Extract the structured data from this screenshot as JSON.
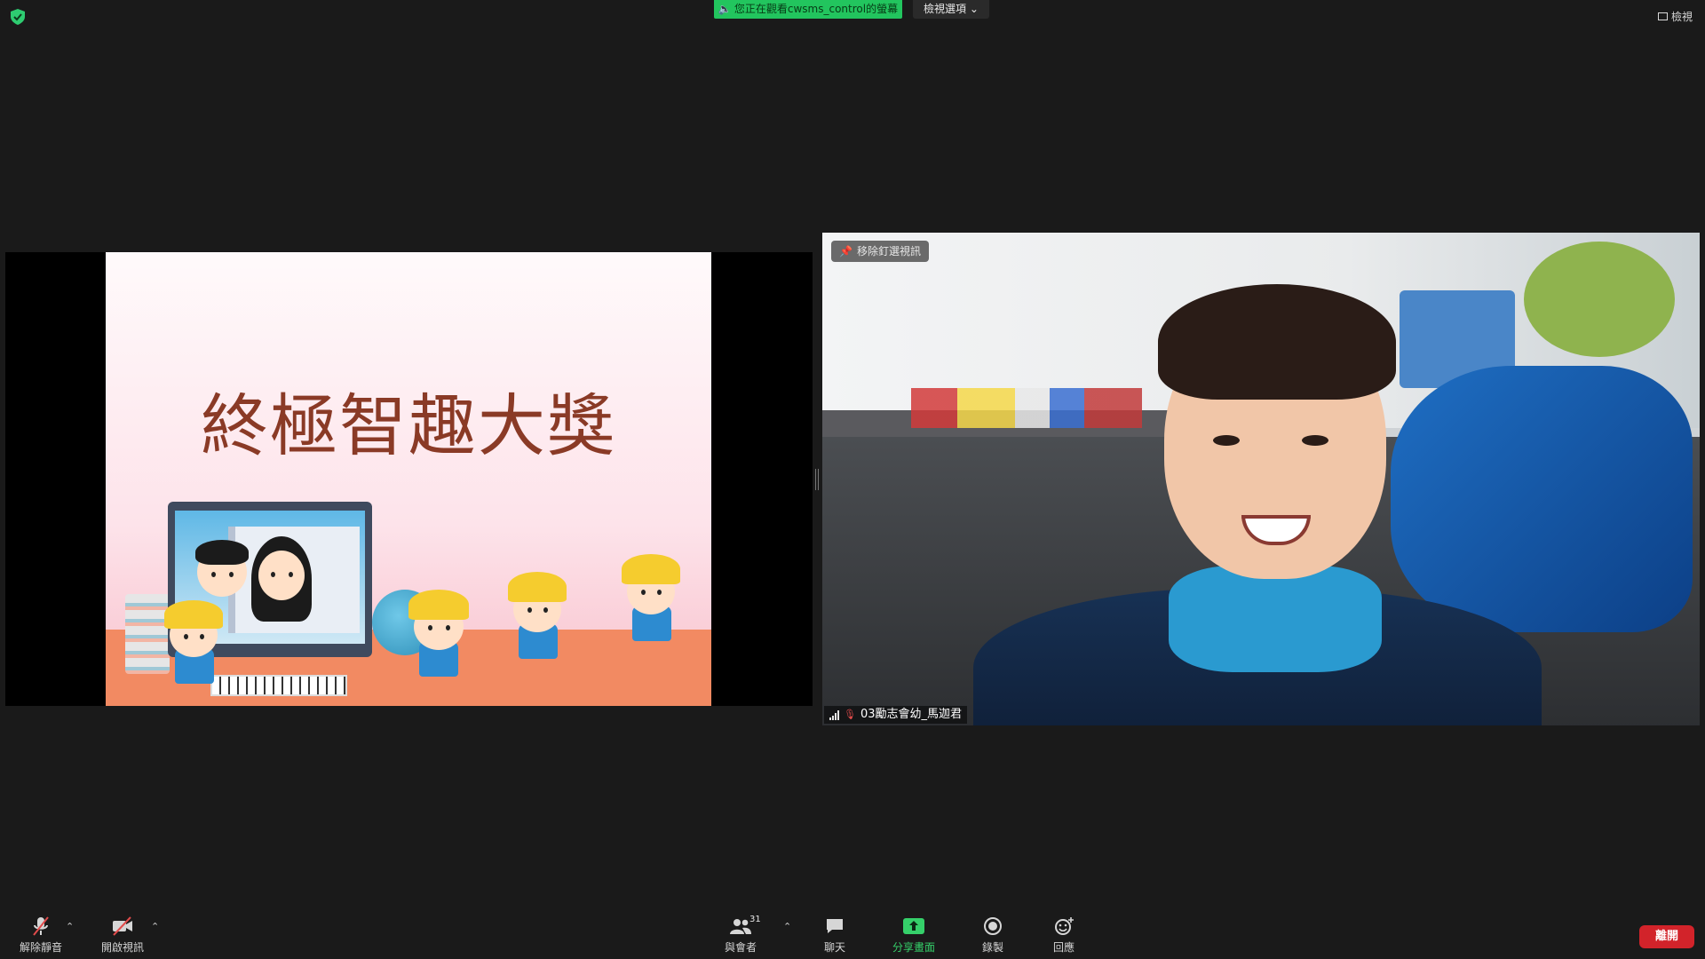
{
  "top_bar": {
    "share_banner": "您正在觀看cwsms_control的螢幕",
    "view_options": "檢視選項",
    "view_button": "檢視",
    "security_icon": "shield-check-icon"
  },
  "shared_screen": {
    "slide_title": "終極智趣大獎"
  },
  "video_tile": {
    "spotlight_label": "移除釘選視訊",
    "participant_name": "03勵志會幼_馬迦君"
  },
  "toolbar": {
    "unmute": "解除靜音",
    "start_video": "開啟視訊",
    "participants": "與會者",
    "participant_count": "31",
    "chat": "聊天",
    "share_screen": "分享畫面",
    "record": "錄製",
    "reactions": "回應",
    "end": "離開"
  },
  "colors": {
    "background": "#1a1a1a",
    "share_banner": "#22c55e",
    "end_button": "#d2232a",
    "share_icon": "#35d06a"
  }
}
